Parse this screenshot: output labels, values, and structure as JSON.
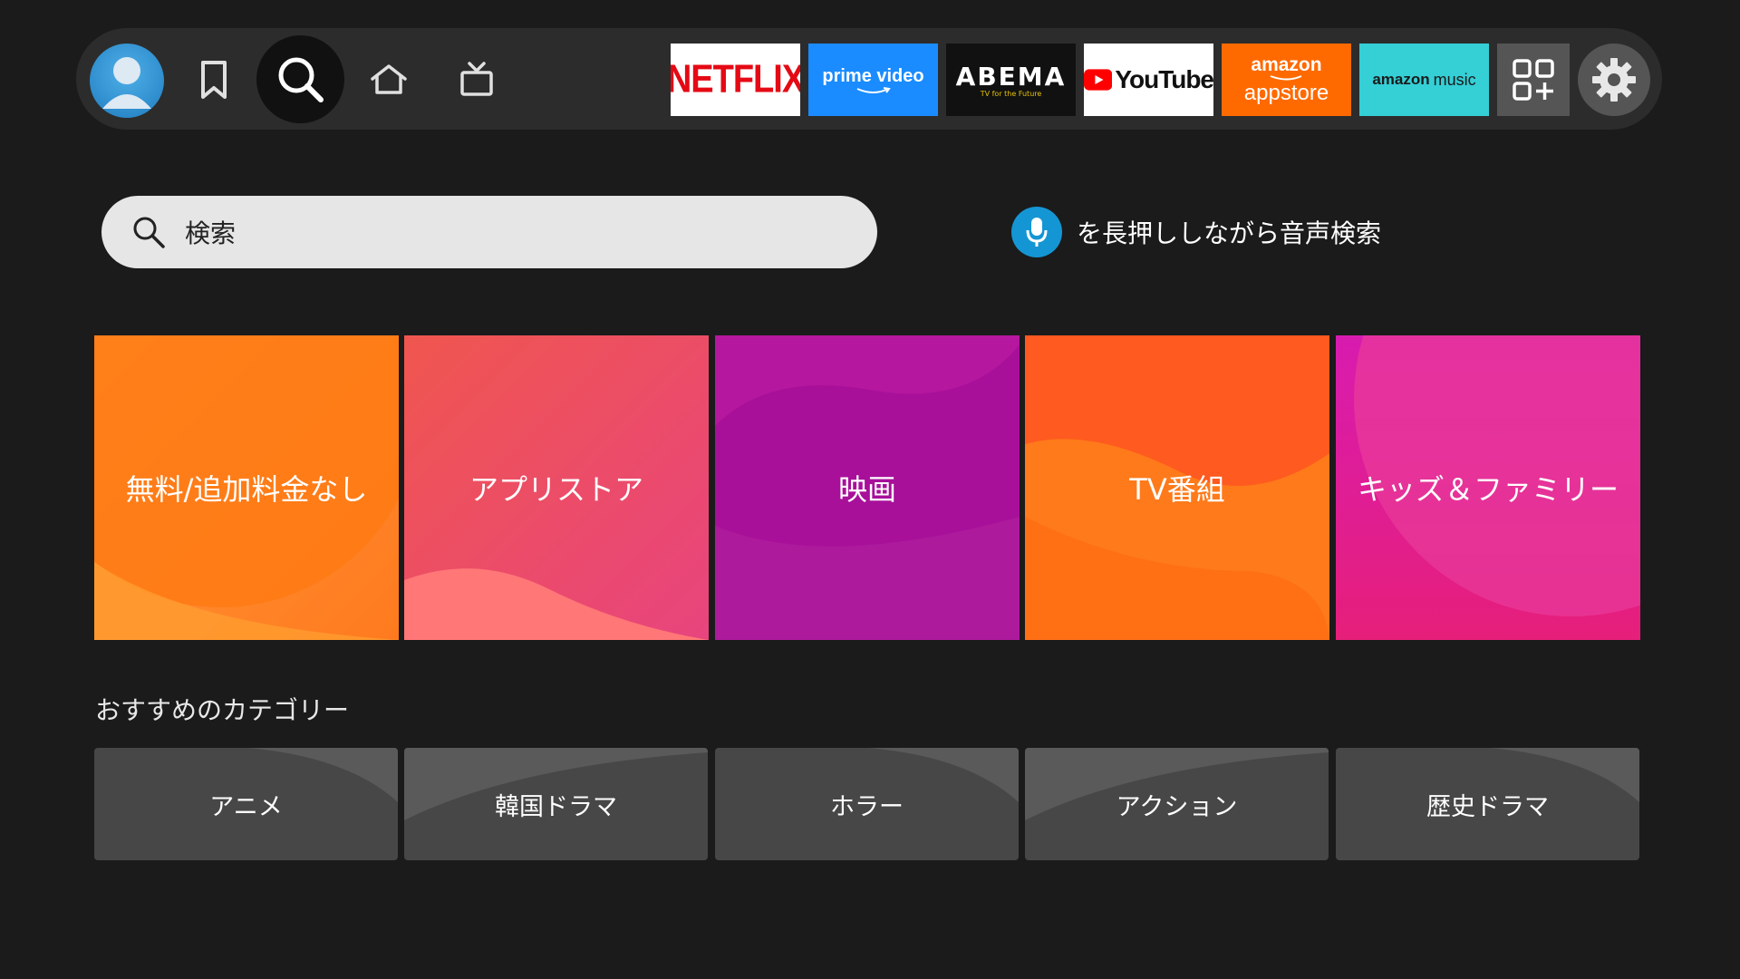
{
  "nav": {
    "apps": [
      {
        "name": "netflix",
        "text": "NETFLIX",
        "color": "#e50914",
        "bg": "#ffffff"
      },
      {
        "name": "prime-video",
        "line1": "prime video",
        "bg": "#1a8cff"
      },
      {
        "name": "abema",
        "line1": "ABEMA",
        "line2": "TV for the Future",
        "bg": "#111111"
      },
      {
        "name": "youtube",
        "text": "YouTube",
        "bg": "#ffffff"
      },
      {
        "name": "amazon-appstore",
        "line1": "amazon",
        "line2": "appstore",
        "bg": "#ff6a00"
      },
      {
        "name": "amazon-music",
        "line1": "amazon",
        "line2": "music",
        "bg": "#35cfd6"
      }
    ]
  },
  "search": {
    "placeholder": "検索"
  },
  "voice": {
    "text": "を長押ししながら音声検索"
  },
  "tiles": [
    {
      "label": "無料/追加料金なし"
    },
    {
      "label": "アプリストア"
    },
    {
      "label": "映画"
    },
    {
      "label": "TV番組"
    },
    {
      "label": "キッズ＆ファミリー"
    }
  ],
  "recommended": {
    "title": "おすすめのカテゴリー",
    "items": [
      {
        "label": "アニメ"
      },
      {
        "label": "韓国ドラマ"
      },
      {
        "label": "ホラー"
      },
      {
        "label": "アクション"
      },
      {
        "label": "歴史ドラマ"
      }
    ]
  }
}
